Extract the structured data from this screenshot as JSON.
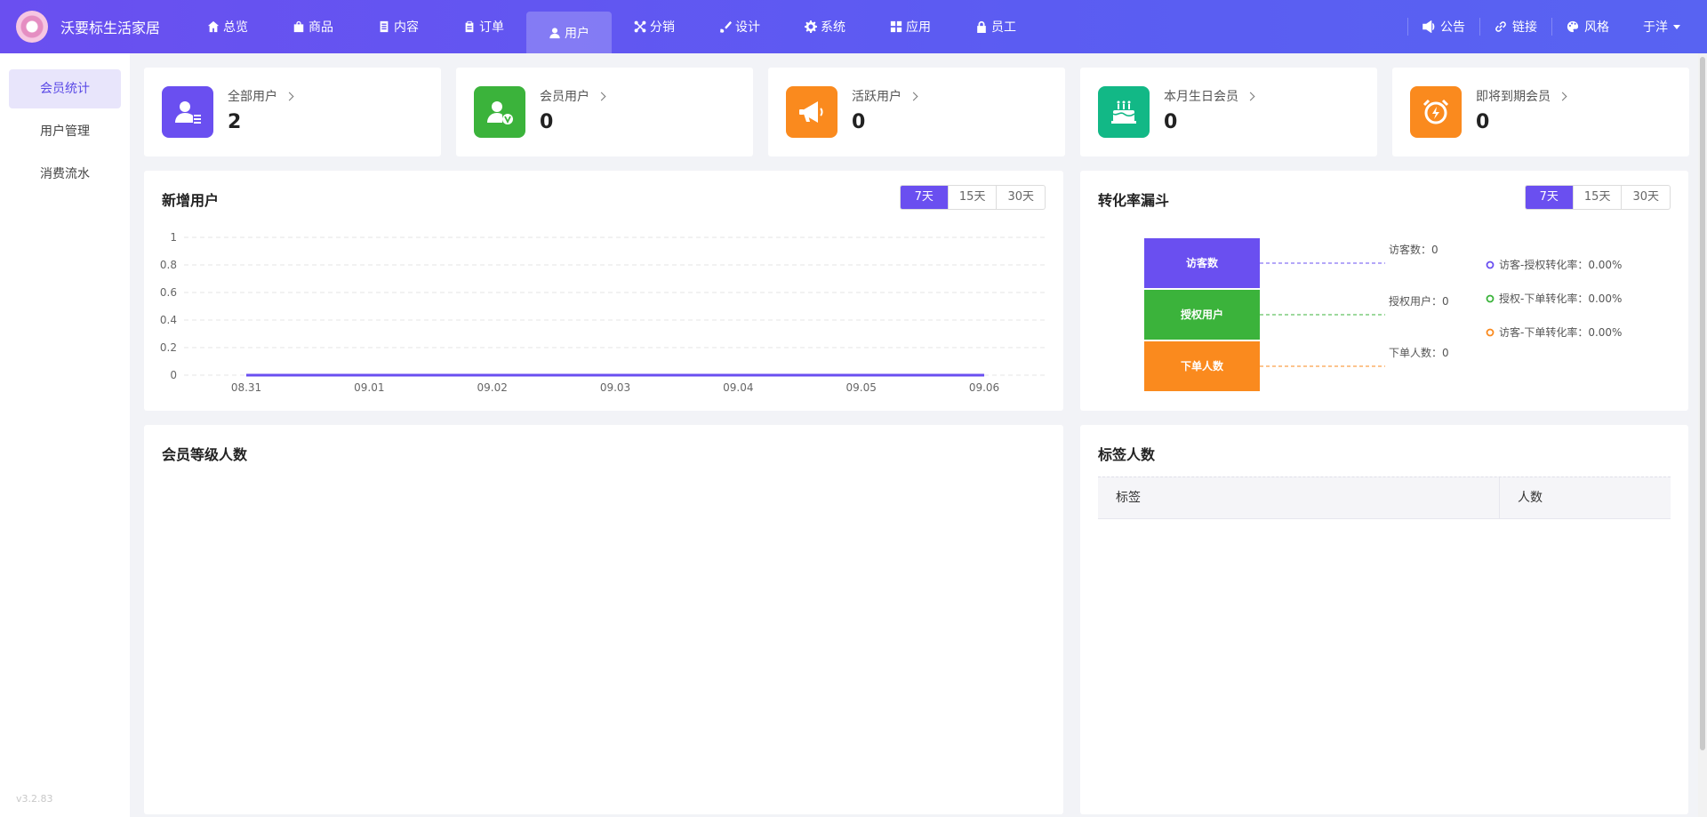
{
  "brand": {
    "name": "沃要标生活家居"
  },
  "nav": [
    {
      "label": "总览",
      "icon": "home-icon"
    },
    {
      "label": "商品",
      "icon": "bag-icon"
    },
    {
      "label": "内容",
      "icon": "document-icon"
    },
    {
      "label": "订单",
      "icon": "clipboard-icon"
    },
    {
      "label": "用户",
      "icon": "user-icon",
      "active": true
    },
    {
      "label": "分销",
      "icon": "network-icon"
    },
    {
      "label": "设计",
      "icon": "brush-icon"
    },
    {
      "label": "系统",
      "icon": "gear-icon"
    },
    {
      "label": "应用",
      "icon": "grid-icon"
    },
    {
      "label": "员工",
      "icon": "lock-icon"
    }
  ],
  "tools": {
    "notice": "公告",
    "link": "链接",
    "style": "风格",
    "user": "于洋"
  },
  "sidebar": {
    "items": [
      {
        "label": "会员统计",
        "active": true
      },
      {
        "label": "用户管理"
      },
      {
        "label": "消费流水"
      }
    ],
    "version": "v3.2.83"
  },
  "stats": [
    {
      "label": "全部用户",
      "value": "2",
      "color": "#6a4ff0",
      "icon": "user-list-icon"
    },
    {
      "label": "会员用户",
      "value": "0",
      "color": "#3bb33b",
      "icon": "vip-user-icon"
    },
    {
      "label": "活跃用户",
      "value": "0",
      "color": "#fa8a1e",
      "icon": "megaphone-icon"
    },
    {
      "label": "本月生日会员",
      "value": "0",
      "color": "#12b886",
      "icon": "cake-icon"
    },
    {
      "label": "即将到期会员",
      "value": "0",
      "color": "#fa8a1e",
      "icon": "alarm-clock-icon"
    }
  ],
  "new_users": {
    "title": "新增用户",
    "ranges": [
      "7天",
      "15天",
      "30天"
    ],
    "selected": "7天"
  },
  "funnel": {
    "title": "转化率漏斗",
    "ranges": [
      "7天",
      "15天",
      "30天"
    ],
    "selected": "7天",
    "stages": [
      {
        "label": "访客数",
        "info": "访客数：0",
        "color": "#6a4ff0"
      },
      {
        "label": "授权用户",
        "info": "授权用户：0",
        "color": "#3bb33b"
      },
      {
        "label": "下单人数",
        "info": "下单人数：0",
        "color": "#fa8a1e"
      }
    ],
    "rates": [
      {
        "text": "访客-授权转化率：0.00%",
        "color": "#6a4ff0"
      },
      {
        "text": "授权-下单转化率：0.00%",
        "color": "#3bb33b"
      },
      {
        "text": "访客-下单转化率：0.00%",
        "color": "#fa8a1e"
      }
    ]
  },
  "level_panel": {
    "title": "会员等级人数"
  },
  "tag_panel": {
    "title": "标签人数",
    "col1": "标签",
    "col2": "人数"
  },
  "chart_data": {
    "type": "line",
    "title": "新增用户",
    "x": [
      "08.31",
      "09.01",
      "09.02",
      "09.03",
      "09.04",
      "09.05",
      "09.06"
    ],
    "series": [
      {
        "values": [
          0,
          0,
          0,
          0,
          0,
          0,
          0
        ],
        "color": "#6a4ff0"
      }
    ],
    "ylim": [
      0,
      1
    ],
    "yticks": [
      "0",
      "0.2",
      "0.4",
      "0.6",
      "0.8",
      "1"
    ],
    "grid": true
  }
}
